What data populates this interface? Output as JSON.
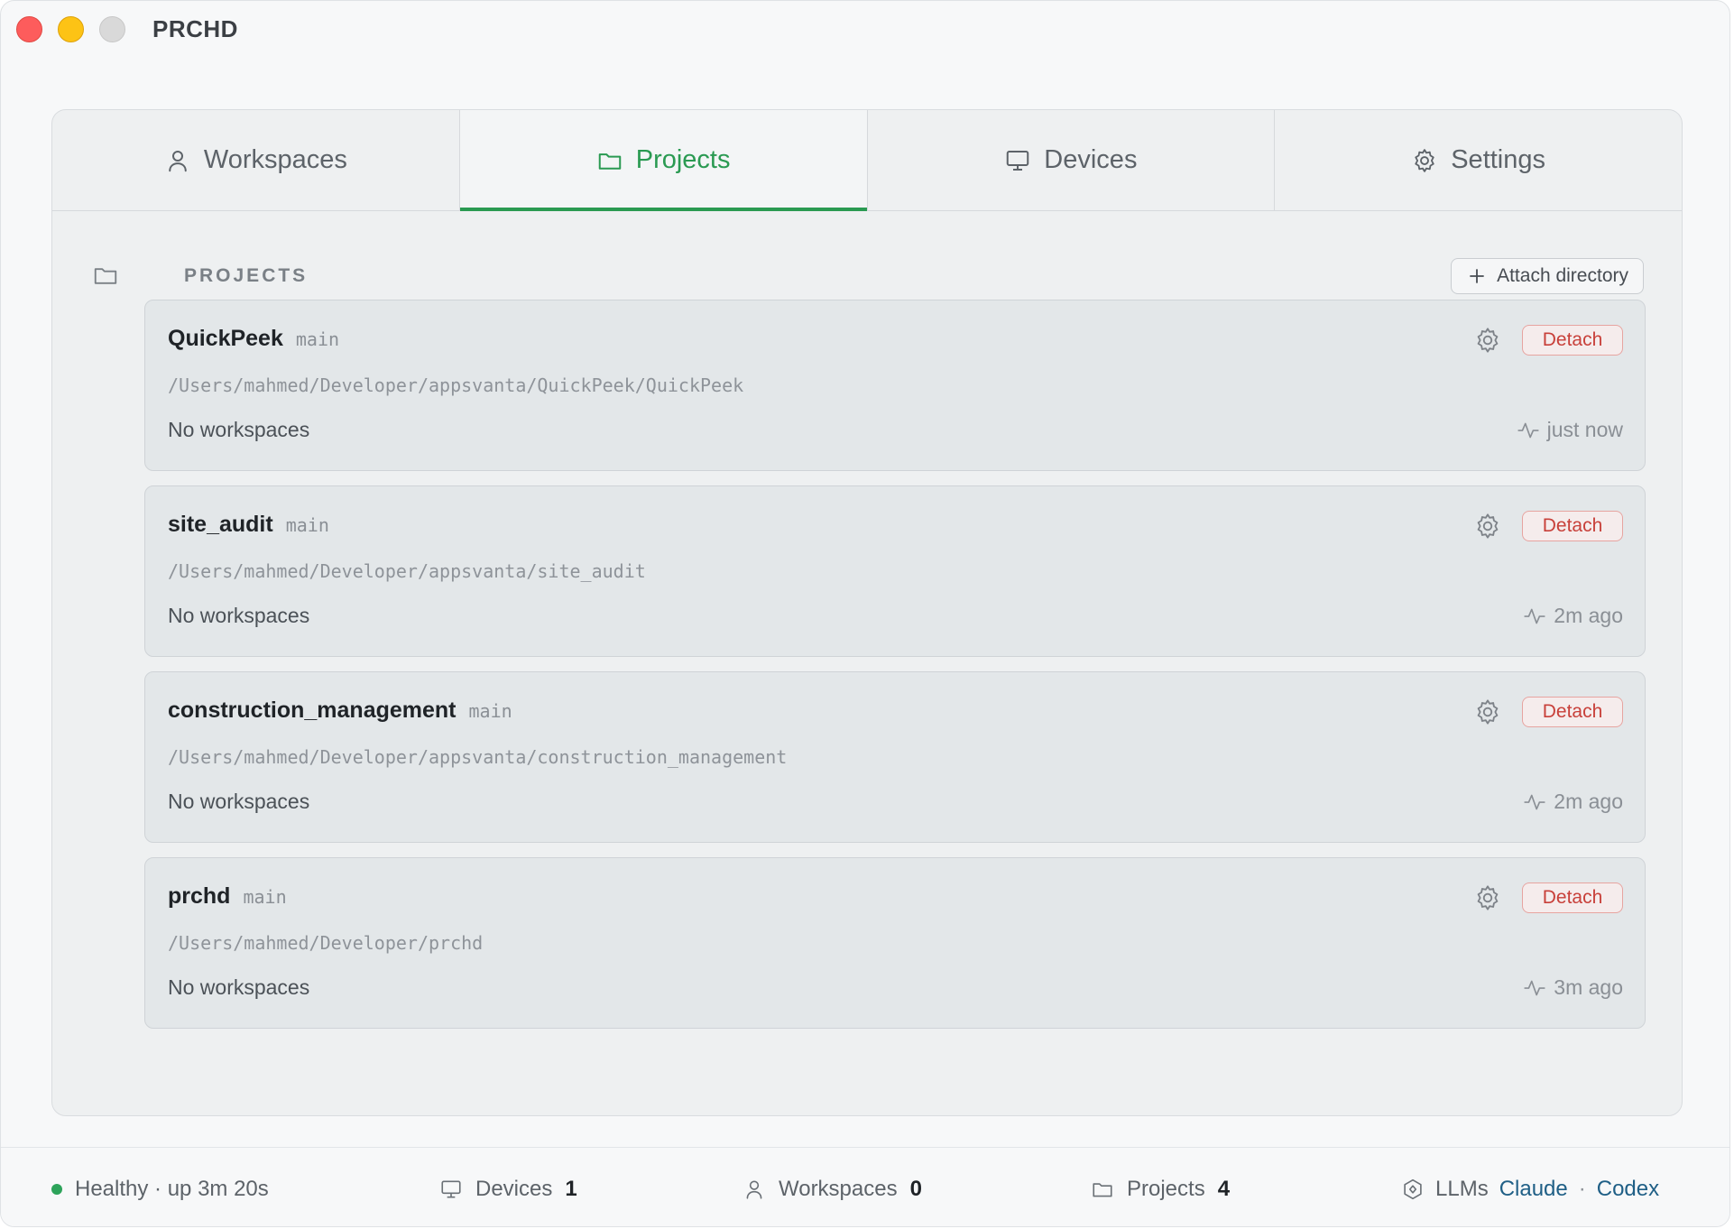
{
  "app": {
    "title": "PRCHD"
  },
  "tabs": [
    {
      "label": "Workspaces",
      "icon": "user-icon",
      "active": false
    },
    {
      "label": "Projects",
      "icon": "folder-icon",
      "active": true
    },
    {
      "label": "Devices",
      "icon": "monitor-icon",
      "active": false
    },
    {
      "label": "Settings",
      "icon": "gear-icon",
      "active": false
    }
  ],
  "section": {
    "title": "PROJECTS",
    "attach_label": "Attach directory"
  },
  "projects": [
    {
      "name": "QuickPeek",
      "branch": "main",
      "path": "/Users/mahmed/Developer/appsvanta/QuickPeek/QuickPeek",
      "status": "No workspaces",
      "detach_label": "Detach",
      "time": "just now"
    },
    {
      "name": "site_audit",
      "branch": "main",
      "path": "/Users/mahmed/Developer/appsvanta/site_audit",
      "status": "No workspaces",
      "detach_label": "Detach",
      "time": "2m ago"
    },
    {
      "name": "construction_management",
      "branch": "main",
      "path": "/Users/mahmed/Developer/appsvanta/construction_management",
      "status": "No workspaces",
      "detach_label": "Detach",
      "time": "2m ago"
    },
    {
      "name": "prchd",
      "branch": "main",
      "path": "/Users/mahmed/Developer/prchd",
      "status": "No workspaces",
      "detach_label": "Detach",
      "time": "3m ago"
    }
  ],
  "statusbar": {
    "health": "Healthy · up 3m 20s",
    "health_color": "#2da35a",
    "devices_label": "Devices",
    "devices_count": "1",
    "workspaces_label": "Workspaces",
    "workspaces_count": "0",
    "projects_label": "Projects",
    "projects_count": "4",
    "llms_label": "LLMs",
    "llm_1": "Claude",
    "llm_sep": "·",
    "llm_2": "Codex"
  },
  "colors": {
    "accent": "#2a9a52",
    "danger": "#c8403a",
    "link": "#1f5f86"
  }
}
